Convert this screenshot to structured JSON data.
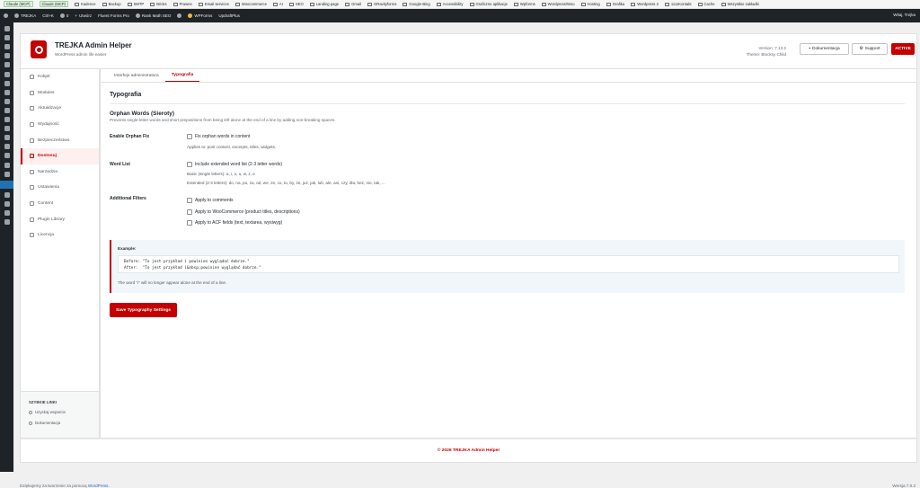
{
  "bookmarks": {
    "tabs": [
      "Claude (MCP)",
      "Claude (MCP)"
    ],
    "items": [
      "Kadence",
      "Backup",
      "SMTP",
      "Bricks",
      "Prawne",
      "Email services",
      "Woocommerce",
      "AI",
      "SEO",
      "Landing page",
      "Gmail",
      "GRavityforms",
      "Google-Bing",
      "Accessibility",
      "Graficzne aplikacje",
      "Wpforms",
      "Wordpress/Woo",
      "Hosting",
      "Grafika",
      "Wordpress 2",
      "1111Kontakt",
      "Cache"
    ],
    "all": "Wszystkie zakładki"
  },
  "admin_bar": {
    "site": "TREJKA",
    "shortcut": "Ctrl+K",
    "comments": "0",
    "new": "Utwórz",
    "fluent": "Fluent Forms Pro",
    "rankmath": "Rank Math SEO",
    "wpforms": "WPForms",
    "updraft": "UpdraftPlus",
    "greeting": "Witaj, Trejka"
  },
  "header": {
    "title": "TREJKA Admin Helper",
    "subtitle": "WordPress admin life easier",
    "version": "Version: 7.13.2",
    "theme": "Theme: Blocksy Child",
    "doc_button": "Dokumentacja",
    "support_button": "Support",
    "status_badge": "ACTIVE"
  },
  "sidebar": {
    "items": [
      "Kokpit",
      "Modules",
      "Aktualizacje",
      "Wydajność",
      "Bezpieczeństwo",
      "Dostosuj",
      "Narzędzia",
      "Ustawienia",
      "Content",
      "Plugin Library",
      "Licencja"
    ],
    "current": "Dostosuj",
    "quick_links_title": "SZYBKIE LINKI",
    "quick_links": [
      "Uzyskaj wsparcie",
      "Dokumentacja"
    ]
  },
  "tabs": [
    "Interfejs administratora",
    "Typografia"
  ],
  "page_title": "Typografia",
  "section": {
    "title": "Orphan Words (Sieroty)",
    "desc": "Prevents single-letter words and short prepositions from being left alone at the end of a line by adding non-breaking spaces."
  },
  "rows": {
    "enable": {
      "label": "Enable Orphan Fix",
      "option": "Fix orphan words in content",
      "hint": "Applies to: post content, excerpts, titles, widgets."
    },
    "wordlist": {
      "label": "Word List",
      "option": "Include extended word list (2-3 letter words)",
      "basic": "Basic (single letters): a, i, o, u, w, z, e",
      "extended": "Extended (2-3 letters): do, na, po, za, od, we, ze, co, to, by, że, już, jak, lub, ale, ani, czy, dla, bez, nie, tak, ..."
    },
    "filters": {
      "label": "Additional Filters",
      "options": [
        "Apply to comments",
        "Apply to WooCommerce (product titles, descriptions)",
        "Apply to ACF fields (text, textarea, wysiwyg)"
      ]
    }
  },
  "example": {
    "title": "Example:",
    "before": "Before: \"To jest przykład i powinien wyglądać dobrze.\"",
    "after": "After:  \"To jest przykład i&nbsp;powinien wyglądać dobrze.\"",
    "note": "The word \"i\" will no longer appear alone at the end of a line."
  },
  "save_button": "Save Typography Settings",
  "footer": "© 2026 TREJKA Admin Helper",
  "wp_footer": {
    "thanks": "Dziękujemy za tworzenie za pomocą",
    "link": "WordPress",
    "version": "Wersja 7.0.2"
  },
  "colors": {
    "accent": "#c40000",
    "adminbar": "#1d2327",
    "link": "#2271b1"
  }
}
